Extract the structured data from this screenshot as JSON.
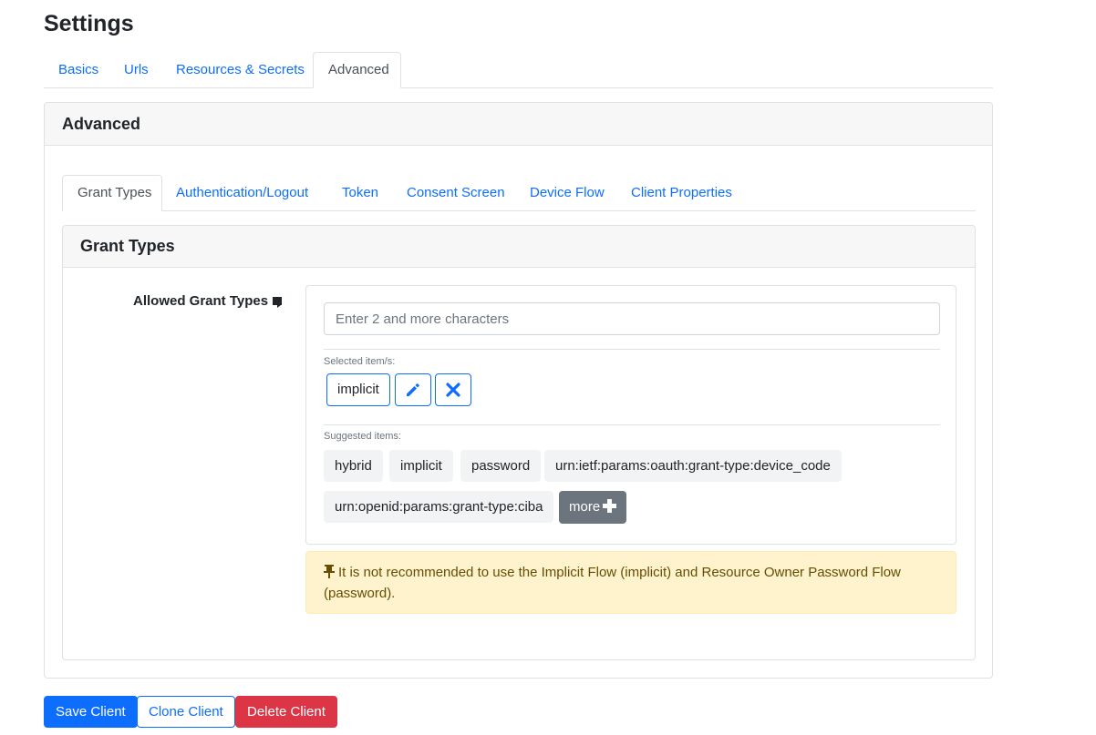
{
  "page": {
    "title": "Settings"
  },
  "top_tabs": [
    {
      "label": "Basics"
    },
    {
      "label": "Urls"
    },
    {
      "label": "Resources & Secrets"
    },
    {
      "label": "Advanced",
      "active": true
    }
  ],
  "advanced": {
    "header": "Advanced",
    "tabs": [
      {
        "label": "Grant Types",
        "active": true
      },
      {
        "label": "Authentication/Logout"
      },
      {
        "label": "Token"
      },
      {
        "label": "Consent Screen"
      },
      {
        "label": "Device Flow"
      },
      {
        "label": "Client Properties"
      }
    ]
  },
  "grant_types": {
    "header": "Grant Types",
    "field_label": "Allowed Grant Types",
    "search": {
      "placeholder": "Enter 2 and more characters",
      "value": ""
    },
    "selected_label": "Selected item/s:",
    "selected": [
      {
        "label": "implicit"
      }
    ],
    "suggested_label": "Suggested items:",
    "suggested": [
      {
        "label": "hybrid"
      },
      {
        "label": "implicit"
      },
      {
        "label": "password"
      },
      {
        "label": "urn:ietf:params:oauth:grant-type:device_code"
      },
      {
        "label": "urn:openid:params:grant-type:ciba"
      }
    ],
    "more_label": "more",
    "warning": "It is not recommended to use the Implicit Flow (implicit) and Resource Owner Password Flow (password)."
  },
  "actions": {
    "save": "Save Client",
    "clone": "Clone Client",
    "delete": "Delete Client"
  },
  "colors": {
    "primary": "#0d6efd",
    "danger": "#dc3545",
    "secondary": "#6c757d",
    "warning_bg": "#fff3cd",
    "warning_text": "#664d03"
  },
  "icons": {
    "edit": "pencil-icon",
    "remove": "x-icon",
    "more": "plus-icon",
    "label_info": "comment-icon",
    "warning": "pin-icon"
  }
}
